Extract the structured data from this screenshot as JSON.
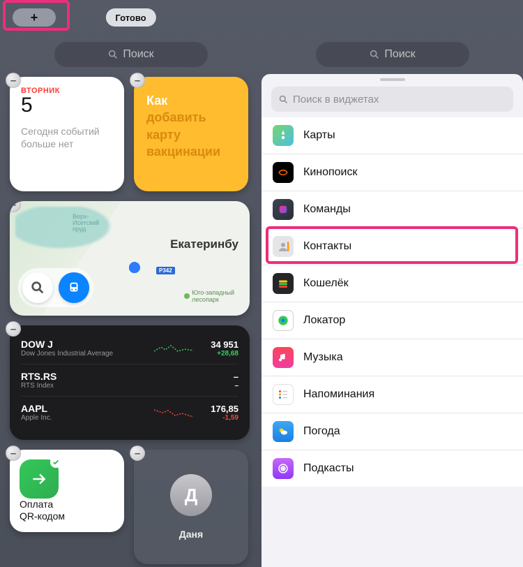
{
  "topbar": {
    "add_label": "+",
    "done_label": "Готово"
  },
  "search": {
    "placeholder_left": "Поиск",
    "placeholder_right": "Поиск",
    "sheet_placeholder": "Поиск в виджетах"
  },
  "calendar": {
    "dow": "ВТОРНИК",
    "day": "5",
    "no_events": "Сегодня событий больше нет"
  },
  "notes": {
    "line1": "Как",
    "line2": "добавить",
    "line3": "карту",
    "line4": "вакцинации"
  },
  "maps": {
    "lake": "Верх-\nИсетский\nпруд",
    "city": "Екатеринбу",
    "road": "Р342",
    "park_name": "Юго-западный\nлесопарк"
  },
  "stocks": [
    {
      "sym": "DOW J",
      "name": "Dow Jones Industrial Average",
      "price": "34 951",
      "chg": "+28,68",
      "dir": "up"
    },
    {
      "sym": "RTS.RS",
      "name": "RTS Index",
      "price": "–",
      "chg": "–",
      "dir": "flat"
    },
    {
      "sym": "AAPL",
      "name": "Apple Inc.",
      "price": "176,85",
      "chg": "-1,59",
      "dir": "down"
    }
  ],
  "qr": {
    "title_l1": "Оплата",
    "title_l2": "QR-кодом"
  },
  "contact_widget": {
    "initial": "Д",
    "name": "Даня"
  },
  "sheet_apps": [
    {
      "key": "maps",
      "label": "Карты"
    },
    {
      "key": "kino",
      "label": "Кинопоиск"
    },
    {
      "key": "shortcut",
      "label": "Команды"
    },
    {
      "key": "contacts",
      "label": "Контакты"
    },
    {
      "key": "wallet",
      "label": "Кошелёк"
    },
    {
      "key": "findmy",
      "label": "Локатор"
    },
    {
      "key": "music",
      "label": "Музыка"
    },
    {
      "key": "remind",
      "label": "Напоминания"
    },
    {
      "key": "weather",
      "label": "Погода"
    },
    {
      "key": "podcasts",
      "label": "Подкасты"
    }
  ]
}
